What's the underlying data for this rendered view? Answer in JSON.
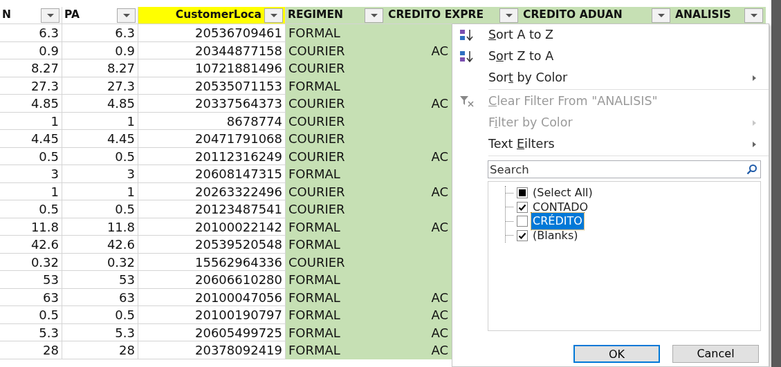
{
  "columns": [
    {
      "label": "N"
    },
    {
      "label": "PA"
    },
    {
      "label": "CustomerLoca"
    },
    {
      "label": "REGIMEN"
    },
    {
      "label": "CREDITO EXPRE"
    },
    {
      "label": "CREDITO ADUAN"
    },
    {
      "label": "ANALISIS"
    }
  ],
  "rows": [
    {
      "mn": "6.3",
      "pa": "6.3",
      "customer": "20536709461",
      "regimen": "FORMAL"
    },
    {
      "mn": "0.9",
      "pa": "0.9",
      "customer": "20344877158",
      "regimen": "COURIER",
      "credito_expre": "AC"
    },
    {
      "mn": "8.27",
      "pa": "8.27",
      "customer": "10721881496",
      "regimen": "COURIER"
    },
    {
      "mn": "27.3",
      "pa": "27.3",
      "customer": "20535071153",
      "regimen": "FORMAL"
    },
    {
      "mn": "4.85",
      "pa": "4.85",
      "customer": "20337564373",
      "regimen": "COURIER",
      "credito_expre": "AC"
    },
    {
      "mn": "1",
      "pa": "1",
      "customer": "8678774",
      "regimen": "COURIER"
    },
    {
      "mn": "4.45",
      "pa": "4.45",
      "customer": "20471791068",
      "regimen": "COURIER"
    },
    {
      "mn": "0.5",
      "pa": "0.5",
      "customer": "20112316249",
      "regimen": "COURIER",
      "credito_expre": "AC"
    },
    {
      "mn": "3",
      "pa": "3",
      "customer": "20608147315",
      "regimen": "FORMAL"
    },
    {
      "mn": "1",
      "pa": "1",
      "customer": "20263322496",
      "regimen": "COURIER",
      "credito_expre": "AC"
    },
    {
      "mn": "0.5",
      "pa": "0.5",
      "customer": "20123487541",
      "regimen": "COURIER"
    },
    {
      "mn": "11.8",
      "pa": "11.8",
      "customer": "20100022142",
      "regimen": "FORMAL",
      "credito_expre": "AC"
    },
    {
      "mn": "42.6",
      "pa": "42.6",
      "customer": "20539520548",
      "regimen": "FORMAL"
    },
    {
      "mn": "0.32",
      "pa": "0.32",
      "customer": "15562964336",
      "regimen": "COURIER"
    },
    {
      "mn": "53",
      "pa": "53",
      "customer": "20606610280",
      "regimen": "FORMAL"
    },
    {
      "mn": "63",
      "pa": "63",
      "customer": "20100047056",
      "regimen": "FORMAL",
      "credito_expre": "AC"
    },
    {
      "mn": "0.5",
      "pa": "0.5",
      "customer": "20100190797",
      "regimen": "FORMAL",
      "credito_expre": "AC"
    },
    {
      "mn": "5.3",
      "pa": "5.3",
      "customer": "20605499725",
      "regimen": "FORMAL",
      "credito_expre": "AC"
    },
    {
      "mn": "28",
      "pa": "28",
      "customer": "20378092419",
      "regimen": "FORMAL",
      "credito_expre": "AC"
    }
  ],
  "filter_menu": {
    "sort_items": [
      {
        "accel": "S",
        "after": "ort A to Z",
        "kind": "sort_ascending",
        "disabled": false,
        "submenu": false
      },
      {
        "before": "S",
        "accel": "o",
        "after": "rt Z to A",
        "kind": "sort_descending",
        "disabled": false,
        "submenu": false
      },
      {
        "before": "Sor",
        "accel": "t",
        "after": " by Color",
        "kind": "plain",
        "disabled": false,
        "submenu": true
      }
    ],
    "filter_items": [
      {
        "accel": "C",
        "after": "lear Filter From \"ANALISIS\"",
        "kind": "clear_filter",
        "disabled": true,
        "submenu": false
      },
      {
        "before": "F",
        "accel": "i",
        "after": "lter by Color",
        "kind": "plain",
        "disabled": true,
        "submenu": true
      },
      {
        "before": "Text ",
        "accel": "E",
        "after": "ilters",
        "kind": "plain",
        "disabled": false,
        "submenu": true
      }
    ],
    "search": {
      "placeholder": "Search"
    },
    "values": [
      {
        "label": "(Select All)",
        "kind": "select_all",
        "partial": true,
        "selected": false
      },
      {
        "label": "CONTADO",
        "kind": "value",
        "checked": true,
        "selected": false
      },
      {
        "label": "CRÉDITO",
        "kind": "value",
        "checked": false,
        "selected": true
      },
      {
        "label": "(Blanks)",
        "kind": "value",
        "checked": true,
        "selected": false
      }
    ],
    "buttons": [
      {
        "label": "OK",
        "default": true
      },
      {
        "label": "Cancel",
        "default": false
      }
    ]
  }
}
